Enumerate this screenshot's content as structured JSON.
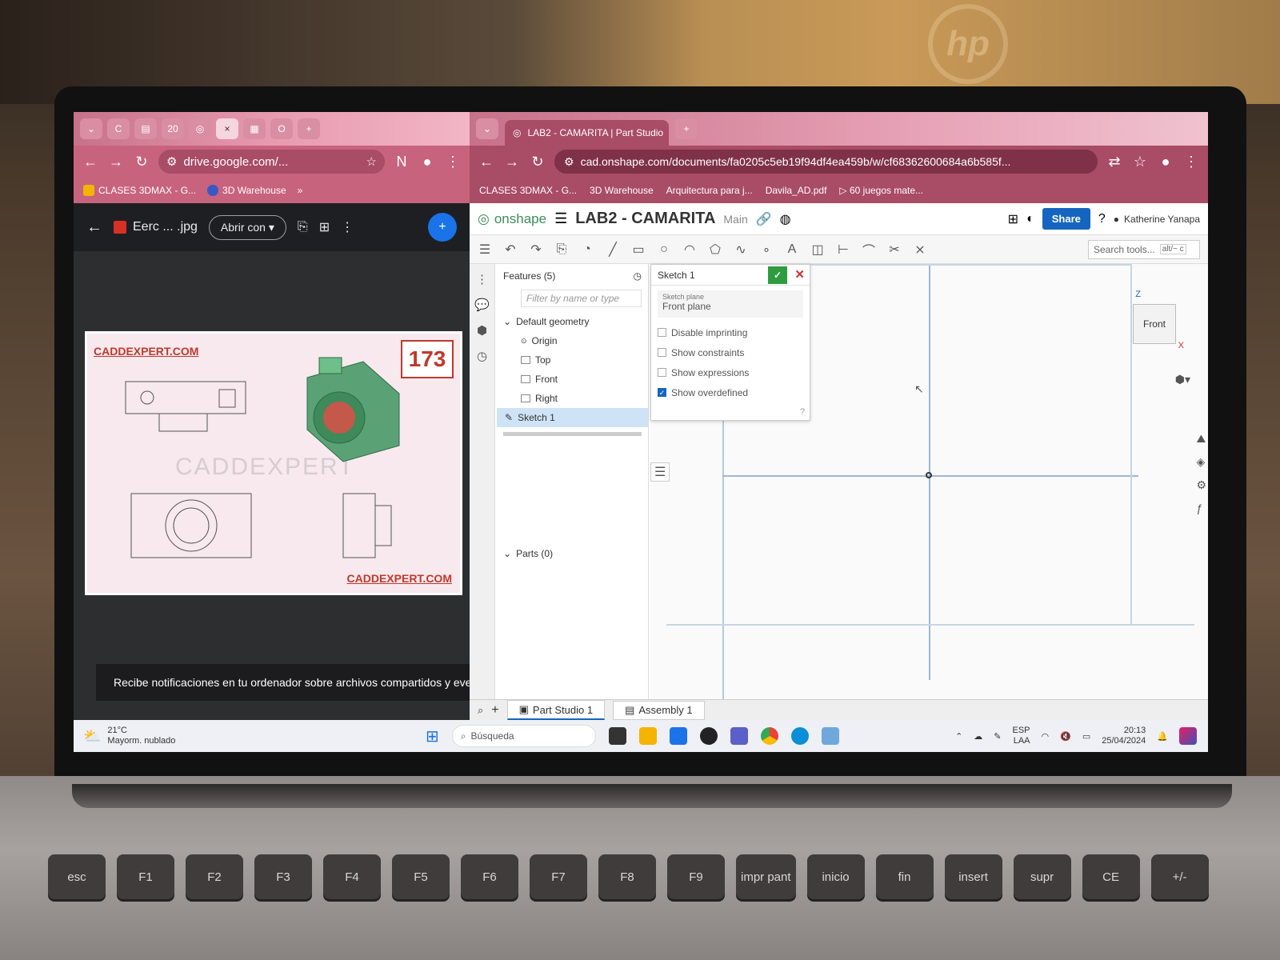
{
  "left_window": {
    "tabs": [
      "C",
      "20",
      "×"
    ],
    "url": "drive.google.com/...",
    "bookmarks": [
      "CLASES 3DMAX - G...",
      "3D Warehouse"
    ],
    "file_title": "Eerc ... .jpg",
    "open_with": "Abrir con",
    "image": {
      "top_label": "CADDEXPERT.COM",
      "bottom_label": "CADDEXPERT.COM",
      "number": "173",
      "watermark": "CADDEXPERT"
    },
    "notification": "Recibe notificaciones en tu ordenador sobre archivos compartidos y eventos"
  },
  "right_window": {
    "tab_title": "LAB2 - CAMARITA | Part Studio",
    "url": "cad.onshape.com/documents/fa0205c5eb19f94df4ea459b/w/cf68362600684a6b585f...",
    "bookmarks": [
      "CLASES 3DMAX - G...",
      "3D Warehouse",
      "Arquitectura para j...",
      "Davila_AD.pdf",
      "▷ 60 juegos mate..."
    ],
    "onshape": {
      "logo": "onshape",
      "doc_title": "LAB2 - CAMARITA",
      "branch": "Main",
      "share": "Share",
      "user": "Katherine Yanapa",
      "search_tools": "Search tools...",
      "search_shortcut": "alt/~ c"
    },
    "features": {
      "header": "Features (5)",
      "filter_placeholder": "Filter by name or type",
      "group": "Default geometry",
      "items": [
        "Origin",
        "Top",
        "Front",
        "Right"
      ],
      "selected": "Sketch 1",
      "parts": "Parts (0)"
    },
    "sketch_dialog": {
      "title": "Sketch 1",
      "plane_label": "Sketch plane",
      "plane_value": "Front plane",
      "options": [
        {
          "label": "Disable imprinting",
          "checked": false
        },
        {
          "label": "Show constraints",
          "checked": false
        },
        {
          "label": "Show expressions",
          "checked": false
        },
        {
          "label": "Show overdefined",
          "checked": true
        }
      ]
    },
    "viewcube": {
      "face": "Front",
      "axis_z": "Z",
      "axis_x": "X"
    },
    "bottom_tabs": [
      "Part Studio 1",
      "Assembly 1"
    ]
  },
  "taskbar": {
    "temp": "21°C",
    "weather": "Mayorm. nublado",
    "search": "Búsqueda",
    "lang1": "ESP",
    "lang2": "LAA",
    "time": "20:13",
    "date": "25/04/2024"
  },
  "keyboard": {
    "row": [
      "esc",
      "F1",
      "F2",
      "F3",
      "F4",
      "F5",
      "F6",
      "F7",
      "F8",
      "F9",
      "impr pant",
      "inicio",
      "fin",
      "insert",
      "supr",
      "CE",
      "+/-"
    ]
  }
}
